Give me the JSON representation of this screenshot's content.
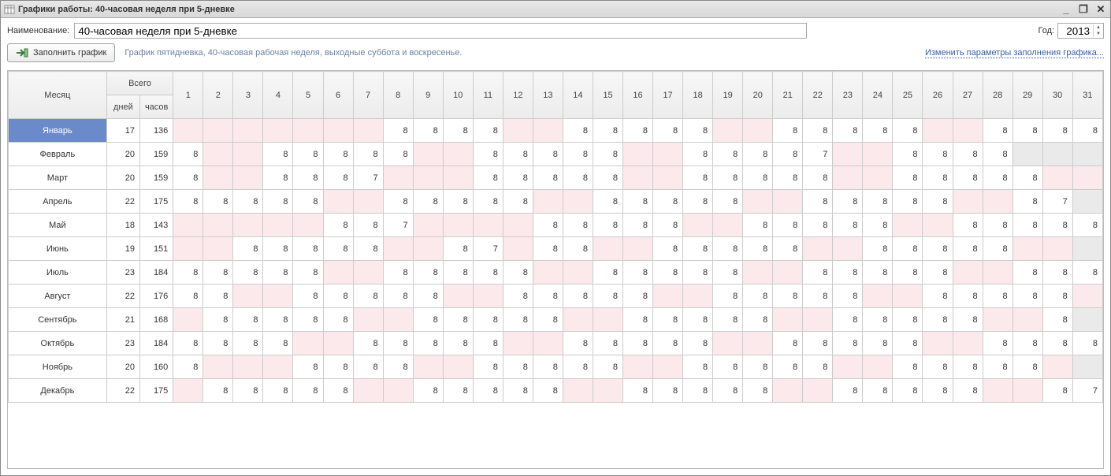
{
  "window_title": "Графики работы: 40-часовая неделя при 5-дневке",
  "labels": {
    "name": "Наименование:",
    "year": "Год:",
    "fill_btn": "Заполнить график",
    "hint": "График пятидневка, 40-часовая рабочая неделя, выходные суббота и воскресенье.",
    "change_params": "Изменить параметры заполнения графика...",
    "month_header": "Месяц",
    "total_header": "Всего",
    "days_header": "дней",
    "hours_header": "часов"
  },
  "name_value": "40-часовая неделя при 5-дневке",
  "year_value": "2013",
  "day_numbers": [
    "1",
    "2",
    "3",
    "4",
    "5",
    "6",
    "7",
    "8",
    "9",
    "10",
    "11",
    "12",
    "13",
    "14",
    "15",
    "16",
    "17",
    "18",
    "19",
    "20",
    "21",
    "22",
    "23",
    "24",
    "25",
    "26",
    "27",
    "28",
    "29",
    "30",
    "31"
  ],
  "months": [
    {
      "name": "Январь",
      "days": 17,
      "hours": 136,
      "selected": true,
      "len": 31,
      "cells": [
        "",
        "",
        "",
        "",
        "",
        "",
        "",
        "8",
        "8",
        "8",
        "8",
        "",
        "",
        "8",
        "8",
        "8",
        "8",
        "8",
        "",
        "",
        "8",
        "8",
        "8",
        "8",
        "8",
        "",
        "",
        "8",
        "8",
        "8",
        "8"
      ]
    },
    {
      "name": "Февраль",
      "days": 20,
      "hours": 159,
      "len": 28,
      "cells": [
        "8",
        "",
        "",
        "8",
        "8",
        "8",
        "8",
        "8",
        "",
        "",
        "8",
        "8",
        "8",
        "8",
        "8",
        "",
        "",
        "8",
        "8",
        "8",
        "8",
        "7",
        "",
        "",
        "8",
        "8",
        "8",
        "8"
      ]
    },
    {
      "name": "Март",
      "days": 20,
      "hours": 159,
      "len": 31,
      "cells": [
        "8",
        "",
        "",
        "8",
        "8",
        "8",
        "7",
        "",
        "",
        "",
        "8",
        "8",
        "8",
        "8",
        "8",
        "",
        "",
        "8",
        "8",
        "8",
        "8",
        "8",
        "",
        "",
        "8",
        "8",
        "8",
        "8",
        "8",
        "",
        ""
      ]
    },
    {
      "name": "Апрель",
      "days": 22,
      "hours": 175,
      "len": 30,
      "cells": [
        "8",
        "8",
        "8",
        "8",
        "8",
        "",
        "",
        "8",
        "8",
        "8",
        "8",
        "8",
        "",
        "",
        "8",
        "8",
        "8",
        "8",
        "8",
        "",
        "",
        "8",
        "8",
        "8",
        "8",
        "8",
        "",
        "",
        "8",
        "7"
      ]
    },
    {
      "name": "Май",
      "days": 18,
      "hours": 143,
      "len": 31,
      "cells": [
        "",
        "",
        "",
        "",
        "",
        "8",
        "8",
        "7",
        "",
        "",
        "",
        "",
        "8",
        "8",
        "8",
        "8",
        "8",
        "",
        "",
        "8",
        "8",
        "8",
        "8",
        "8",
        "",
        "",
        "8",
        "8",
        "8",
        "8",
        "8"
      ]
    },
    {
      "name": "Июнь",
      "days": 19,
      "hours": 151,
      "len": 30,
      "cells": [
        "",
        "",
        "8",
        "8",
        "8",
        "8",
        "8",
        "",
        "",
        "8",
        "7",
        "",
        "8",
        "8",
        "",
        "",
        "8",
        "8",
        "8",
        "8",
        "8",
        "",
        "",
        "8",
        "8",
        "8",
        "8",
        "8",
        "",
        ""
      ]
    },
    {
      "name": "Июль",
      "days": 23,
      "hours": 184,
      "len": 31,
      "cells": [
        "8",
        "8",
        "8",
        "8",
        "8",
        "",
        "",
        "8",
        "8",
        "8",
        "8",
        "8",
        "",
        "",
        "8",
        "8",
        "8",
        "8",
        "8",
        "",
        "",
        "8",
        "8",
        "8",
        "8",
        "8",
        "",
        "",
        "8",
        "8",
        "8"
      ]
    },
    {
      "name": "Август",
      "days": 22,
      "hours": 176,
      "len": 31,
      "cells": [
        "8",
        "8",
        "",
        "",
        "8",
        "8",
        "8",
        "8",
        "8",
        "",
        "",
        "8",
        "8",
        "8",
        "8",
        "8",
        "",
        "",
        "8",
        "8",
        "8",
        "8",
        "8",
        "",
        "",
        "8",
        "8",
        "8",
        "8",
        "8",
        ""
      ]
    },
    {
      "name": "Сентябрь",
      "days": 21,
      "hours": 168,
      "len": 30,
      "cells": [
        "",
        "8",
        "8",
        "8",
        "8",
        "8",
        "",
        "",
        "8",
        "8",
        "8",
        "8",
        "8",
        "",
        "",
        "8",
        "8",
        "8",
        "8",
        "8",
        "",
        "",
        "8",
        "8",
        "8",
        "8",
        "8",
        "",
        "",
        "8"
      ]
    },
    {
      "name": "Октябрь",
      "days": 23,
      "hours": 184,
      "len": 31,
      "cells": [
        "8",
        "8",
        "8",
        "8",
        "",
        "",
        "8",
        "8",
        "8",
        "8",
        "8",
        "",
        "",
        "8",
        "8",
        "8",
        "8",
        "8",
        "",
        "",
        "8",
        "8",
        "8",
        "8",
        "8",
        "",
        "",
        "8",
        "8",
        "8",
        "8"
      ]
    },
    {
      "name": "Ноябрь",
      "days": 20,
      "hours": 160,
      "len": 30,
      "cells": [
        "8",
        "",
        "",
        "",
        "8",
        "8",
        "8",
        "8",
        "",
        "",
        "8",
        "8",
        "8",
        "8",
        "8",
        "",
        "",
        "8",
        "8",
        "8",
        "8",
        "8",
        "",
        "",
        "8",
        "8",
        "8",
        "8",
        "8",
        ""
      ]
    },
    {
      "name": "Декабрь",
      "days": 22,
      "hours": 175,
      "len": 31,
      "cells": [
        "",
        "8",
        "8",
        "8",
        "8",
        "8",
        "",
        "",
        "8",
        "8",
        "8",
        "8",
        "8",
        "",
        "",
        "8",
        "8",
        "8",
        "8",
        "8",
        "",
        "",
        "8",
        "8",
        "8",
        "8",
        "8",
        "",
        "",
        "8",
        "7"
      ]
    }
  ]
}
